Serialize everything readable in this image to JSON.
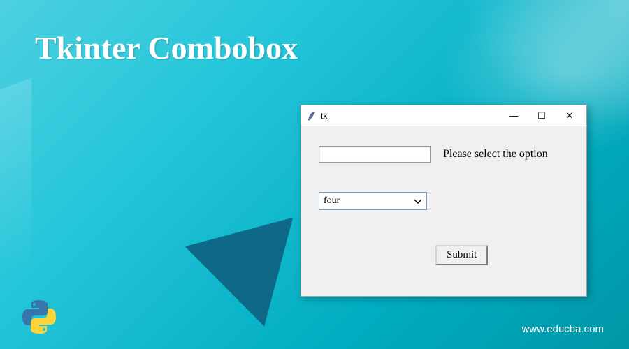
{
  "header": {
    "title": "Tkinter Combobox"
  },
  "window": {
    "title": "tk",
    "controls": {
      "minimize_glyph": "—",
      "maximize_glyph": "☐",
      "close_glyph": "✕"
    },
    "body": {
      "input_value": "",
      "prompt_text": "Please select the option",
      "combo_selected": "four",
      "submit_label": "Submit"
    }
  },
  "footer": {
    "watermark": "www.educba.com"
  }
}
